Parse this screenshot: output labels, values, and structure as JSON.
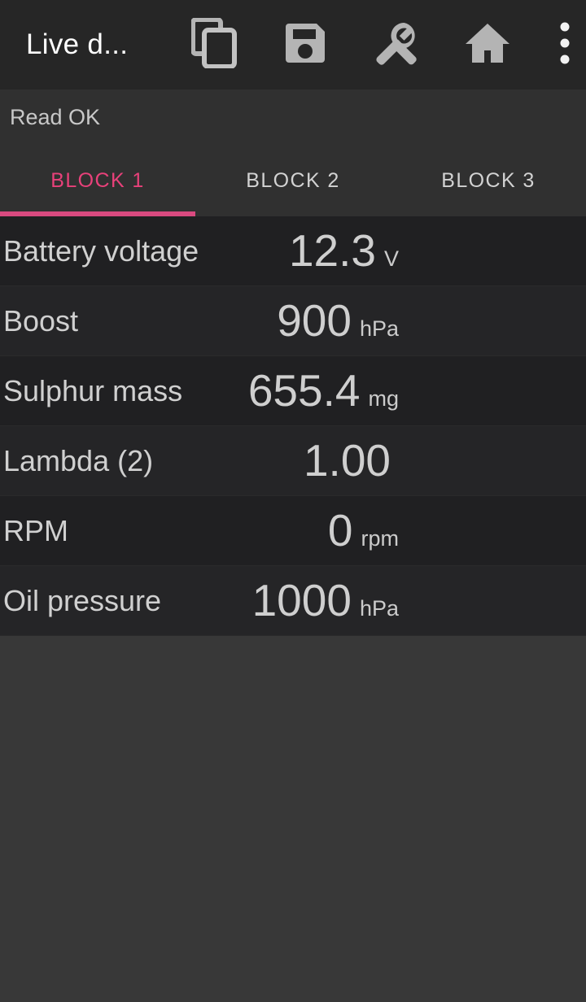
{
  "appbar": {
    "title": "Live d...",
    "actions": [
      {
        "name": "copy-icon",
        "label": "Copy"
      },
      {
        "name": "save-icon",
        "label": "Save"
      },
      {
        "name": "settings-icon",
        "label": "Settings"
      },
      {
        "name": "home-icon",
        "label": "Home"
      },
      {
        "name": "overflow-menu-icon",
        "label": "More options"
      }
    ]
  },
  "status": {
    "text": "Read OK"
  },
  "tabs": {
    "items": [
      {
        "label": "BLOCK 1",
        "active": true
      },
      {
        "label": "BLOCK 2",
        "active": false
      },
      {
        "label": "BLOCK 3",
        "active": false
      }
    ],
    "active_index": 0
  },
  "rows": [
    {
      "label": "Battery voltage",
      "value": "12.3",
      "unit": "V"
    },
    {
      "label": "Boost",
      "value": "900",
      "unit": "hPa"
    },
    {
      "label": "Sulphur mass",
      "value": "655.4",
      "unit": "mg"
    },
    {
      "label": "Lambda (2)",
      "value": "1.00",
      "unit": ""
    },
    {
      "label": "RPM",
      "value": "0",
      "unit": "rpm"
    },
    {
      "label": "Oil pressure",
      "value": "1000",
      "unit": "hPa"
    }
  ],
  "colors": {
    "accent": "#e8417a",
    "indicator": "#d94a80",
    "appbar_bg": "#262626",
    "page_bg": "#303030",
    "row_bg_odd": "#202022",
    "row_bg_even": "#252527",
    "filler_bg": "#383838",
    "text_primary": "#d0d0d0",
    "icon": "#b4b4b4"
  }
}
